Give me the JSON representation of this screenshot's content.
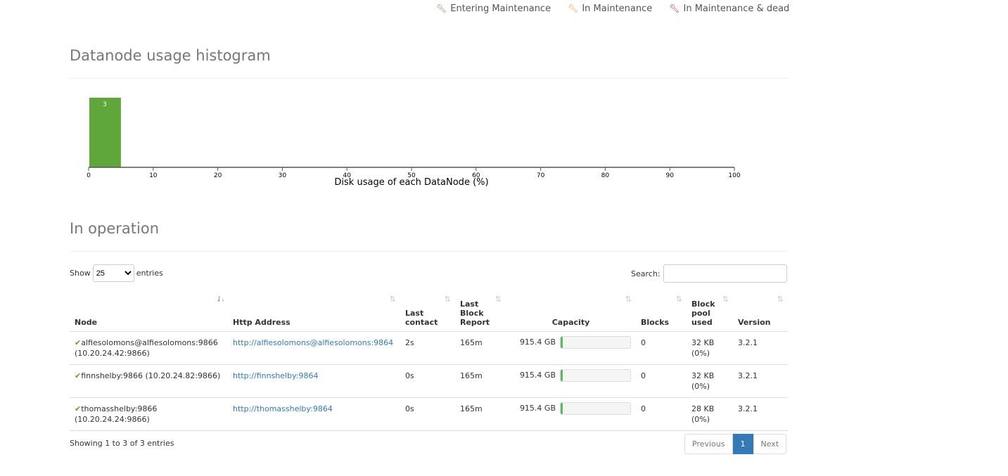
{
  "legend": [
    {
      "label": "Entering Maintenance",
      "icon": "wrench-icon",
      "color": "#5a9e3a"
    },
    {
      "label": "In Maintenance",
      "icon": "wrench-icon",
      "color": "#f0a030"
    },
    {
      "label": "In Maintenance & dead",
      "icon": "wrench-icon",
      "color": "#c7254e"
    }
  ],
  "histogram": {
    "title": "Datanode usage histogram"
  },
  "chart_data": {
    "type": "bar",
    "title": "",
    "xlabel": "Disk usage of each DataNode (%)",
    "xlim": [
      0,
      100
    ],
    "xticks": [
      0,
      10,
      20,
      30,
      40,
      50,
      60,
      70,
      80,
      90,
      100
    ],
    "bins": [
      {
        "x0": 0,
        "x1": 5,
        "count": 3
      }
    ],
    "color": "#5fa73a"
  },
  "operation": {
    "title": "In operation",
    "show_label": "Show",
    "entries_label": "entries",
    "page_size": "25",
    "search_label": "Search:",
    "search_value": "",
    "columns": [
      "Node",
      "Http Address",
      "Last contact",
      "Last Block Report",
      "Capacity",
      "Blocks",
      "Block pool used",
      "Version"
    ],
    "rows": [
      {
        "node": "alfiesolomons@alfiesolomons:9866",
        "ip": "(10.20.24.42:9866)",
        "http": "http://alfiesolomons@alfiesolomons:9864",
        "contact": "2s",
        "report": "165m",
        "capacity": "915.4 GB",
        "used_pct": 1,
        "blocks": "0",
        "pool": "32 KB",
        "pool_pct": "(0%)",
        "version": "3.2.1"
      },
      {
        "node": "finnshelby:9866",
        "ip": "(10.20.24.82:9866)",
        "http": "http://finnshelby:9864",
        "contact": "0s",
        "report": "165m",
        "capacity": "915.4 GB",
        "used_pct": 1,
        "blocks": "0",
        "pool": "32 KB",
        "pool_pct": "(0%)",
        "version": "3.2.1"
      },
      {
        "node": "thomasshelby:9866",
        "ip": "(10.20.24.24:9866)",
        "http": "http://thomasshelby:9864",
        "contact": "0s",
        "report": "165m",
        "capacity": "915.4 GB",
        "used_pct": 1,
        "blocks": "0",
        "pool": "28 KB",
        "pool_pct": "(0%)",
        "version": "3.2.1"
      }
    ],
    "info": "Showing 1 to 3 of 3 entries",
    "prev": "Previous",
    "page": "1",
    "next": "Next"
  }
}
